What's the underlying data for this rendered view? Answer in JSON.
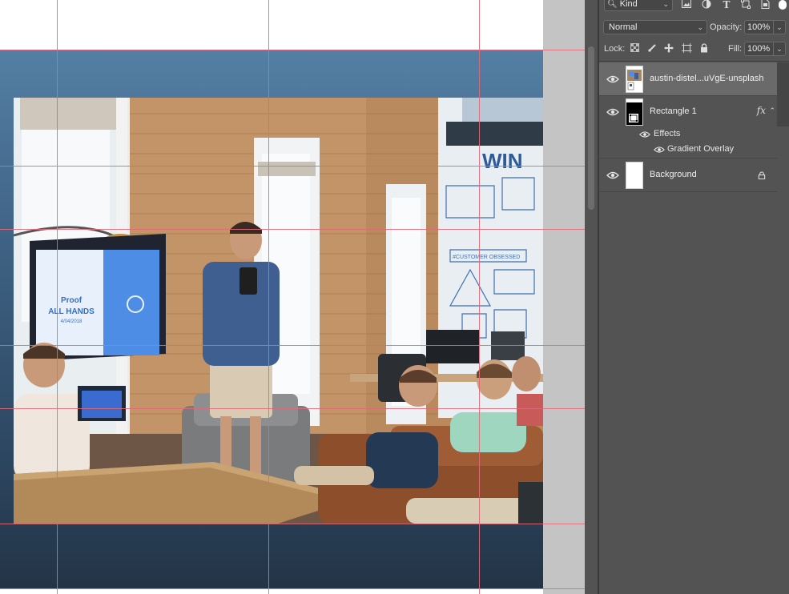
{
  "filter_bar": {
    "kind_label": "Kind",
    "icons": [
      "image-filter-icon",
      "adjustment-filter-icon",
      "type-filter-icon",
      "shape-filter-icon",
      "smart-object-filter-icon"
    ]
  },
  "blend": {
    "mode": "Normal",
    "opacity_label": "Opacity:",
    "opacity_value": "100%"
  },
  "lock": {
    "label": "Lock:",
    "icons": [
      "lock-transparent-pixels-icon",
      "lock-image-pixels-icon",
      "lock-position-icon",
      "lock-artboard-icon",
      "lock-all-icon"
    ],
    "fill_label": "Fill:",
    "fill_value": "100%"
  },
  "layers": {
    "items": [
      {
        "name": "austin-distel...uVgE-unsplash",
        "visible": true,
        "selected": true
      },
      {
        "name": "Rectangle 1",
        "visible": true,
        "fx": "fx",
        "effects_label": "Effects",
        "effects": [
          {
            "name": "Gradient Overlay",
            "visible": true
          }
        ]
      },
      {
        "name": "Background",
        "visible": true,
        "locked": true
      }
    ]
  },
  "canvas": {
    "photo_scene": {
      "screen_text_line1": "Proof",
      "screen_text_line2": "ALL HANDS",
      "screen_text_line3": "4/04/2018",
      "wall_text": "WIN",
      "poster_text": "#CUSTOMER OBSESSED"
    }
  },
  "colors": {
    "panel_bg": "#535353",
    "selected_row": "#6a6a6a",
    "guide_line": "#e06a7a",
    "gradient_top": "#547fa4",
    "gradient_bottom": "#233446",
    "pasteboard": "#c4c4c4"
  }
}
